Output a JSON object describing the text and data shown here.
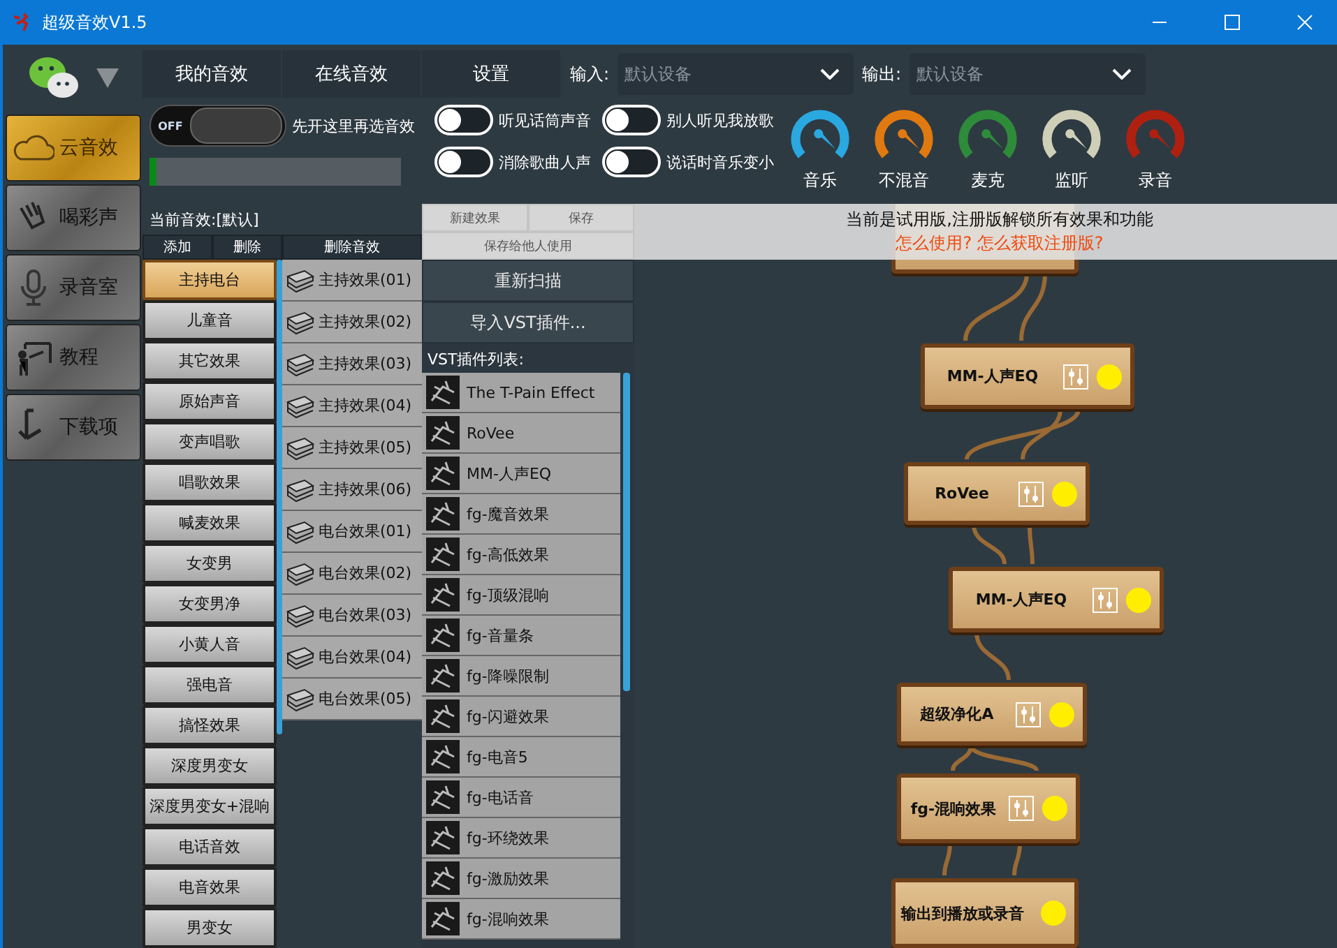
{
  "window": {
    "title": "超级音效V1.5"
  },
  "sidebar": {
    "items": [
      {
        "label": "云音效",
        "selected": true
      },
      {
        "label": "喝彩声",
        "selected": false
      },
      {
        "label": "录音室",
        "selected": false
      },
      {
        "label": "教程",
        "selected": false
      },
      {
        "label": "下载项",
        "selected": false
      }
    ]
  },
  "tabs": [
    {
      "label": "我的音效",
      "selected": false
    },
    {
      "label": "在线音效",
      "selected": false
    },
    {
      "label": "设置",
      "selected": false
    }
  ],
  "input": {
    "label": "输入:",
    "placeholder": "默认设备"
  },
  "output": {
    "label": "输出:",
    "placeholder": "默认设备"
  },
  "main_switch": {
    "label": "OFF",
    "on": false,
    "hint": "先开这里再选音效"
  },
  "meter": {
    "level": 0.03
  },
  "toggles": [
    {
      "label": "听见话筒声音",
      "on": false
    },
    {
      "label": "别人听见我放歌",
      "on": false
    },
    {
      "label": "消除歌曲人声",
      "on": false
    },
    {
      "label": "说话时音乐变小",
      "on": false
    }
  ],
  "gauges": [
    {
      "label": "音乐",
      "color": "#2aa8e0"
    },
    {
      "label": "不混音",
      "color": "#e07a10"
    },
    {
      "label": "麦克",
      "color": "#2e8b3a"
    },
    {
      "label": "监听",
      "color": "#cfcfb8"
    },
    {
      "label": "录音",
      "color": "#b02010"
    }
  ],
  "current_effect": "当前音效:[默认]",
  "list_buttons": [
    "添加",
    "删除",
    "删除音效"
  ],
  "presets": [
    {
      "label": "主持电台",
      "selected": true
    },
    {
      "label": "儿童音",
      "selected": false
    },
    {
      "label": "其它效果",
      "selected": false
    },
    {
      "label": "原始声音",
      "selected": false
    },
    {
      "label": "变声唱歌",
      "selected": false
    },
    {
      "label": "唱歌效果",
      "selected": false
    },
    {
      "label": "喊麦效果",
      "selected": false
    },
    {
      "label": "女变男",
      "selected": false
    },
    {
      "label": "女变男净",
      "selected": false
    },
    {
      "label": "小黄人音",
      "selected": false
    },
    {
      "label": "强电音",
      "selected": false
    },
    {
      "label": "搞怪效果",
      "selected": false
    },
    {
      "label": "深度男变女",
      "selected": false
    },
    {
      "label": "深度男变女+混响",
      "selected": false
    },
    {
      "label": "电话音效",
      "selected": false
    },
    {
      "label": "电音效果",
      "selected": false
    },
    {
      "label": "男变女",
      "selected": false
    }
  ],
  "effects": [
    "主持效果(01)",
    "主持效果(02)",
    "主持效果(03)",
    "主持效果(04)",
    "主持效果(05)",
    "主持效果(06)",
    "电台效果(01)",
    "电台效果(02)",
    "电台效果(03)",
    "电台效果(04)",
    "电台效果(05)"
  ],
  "effect_buttons": [
    {
      "label": "新建效果",
      "disabled": true
    },
    {
      "label": "保存",
      "disabled": true
    },
    {
      "label": "保存给他人使用",
      "disabled": true
    }
  ],
  "vst_buttons": [
    "重新扫描",
    "导入VST插件..."
  ],
  "vst_list_label": "VST插件列表:",
  "vst_plugins": [
    "The T-Pain Effect",
    "RoVee",
    "MM-人声EQ",
    "fg-魔音效果",
    "fg-高低效果",
    "fg-顶级混响",
    "fg-音量条",
    "fg-降噪限制",
    "fg-闪避效果",
    "fg-电音5",
    "fg-电话音",
    "fg-环绕效果",
    "fg-激励效果",
    "fg-混响效果"
  ],
  "banner": {
    "message": "当前是试用版,注册版解锁所有效果和功能",
    "link": "怎么使用? 怎么获取注册版?"
  },
  "chain": [
    {
      "label": "MM-人声EQ"
    },
    {
      "label": "RoVee"
    },
    {
      "label": "MM-人声EQ"
    },
    {
      "label": "超级净化A"
    },
    {
      "label": "fg-混响效果"
    },
    {
      "label": "输出到播放或录音"
    }
  ]
}
